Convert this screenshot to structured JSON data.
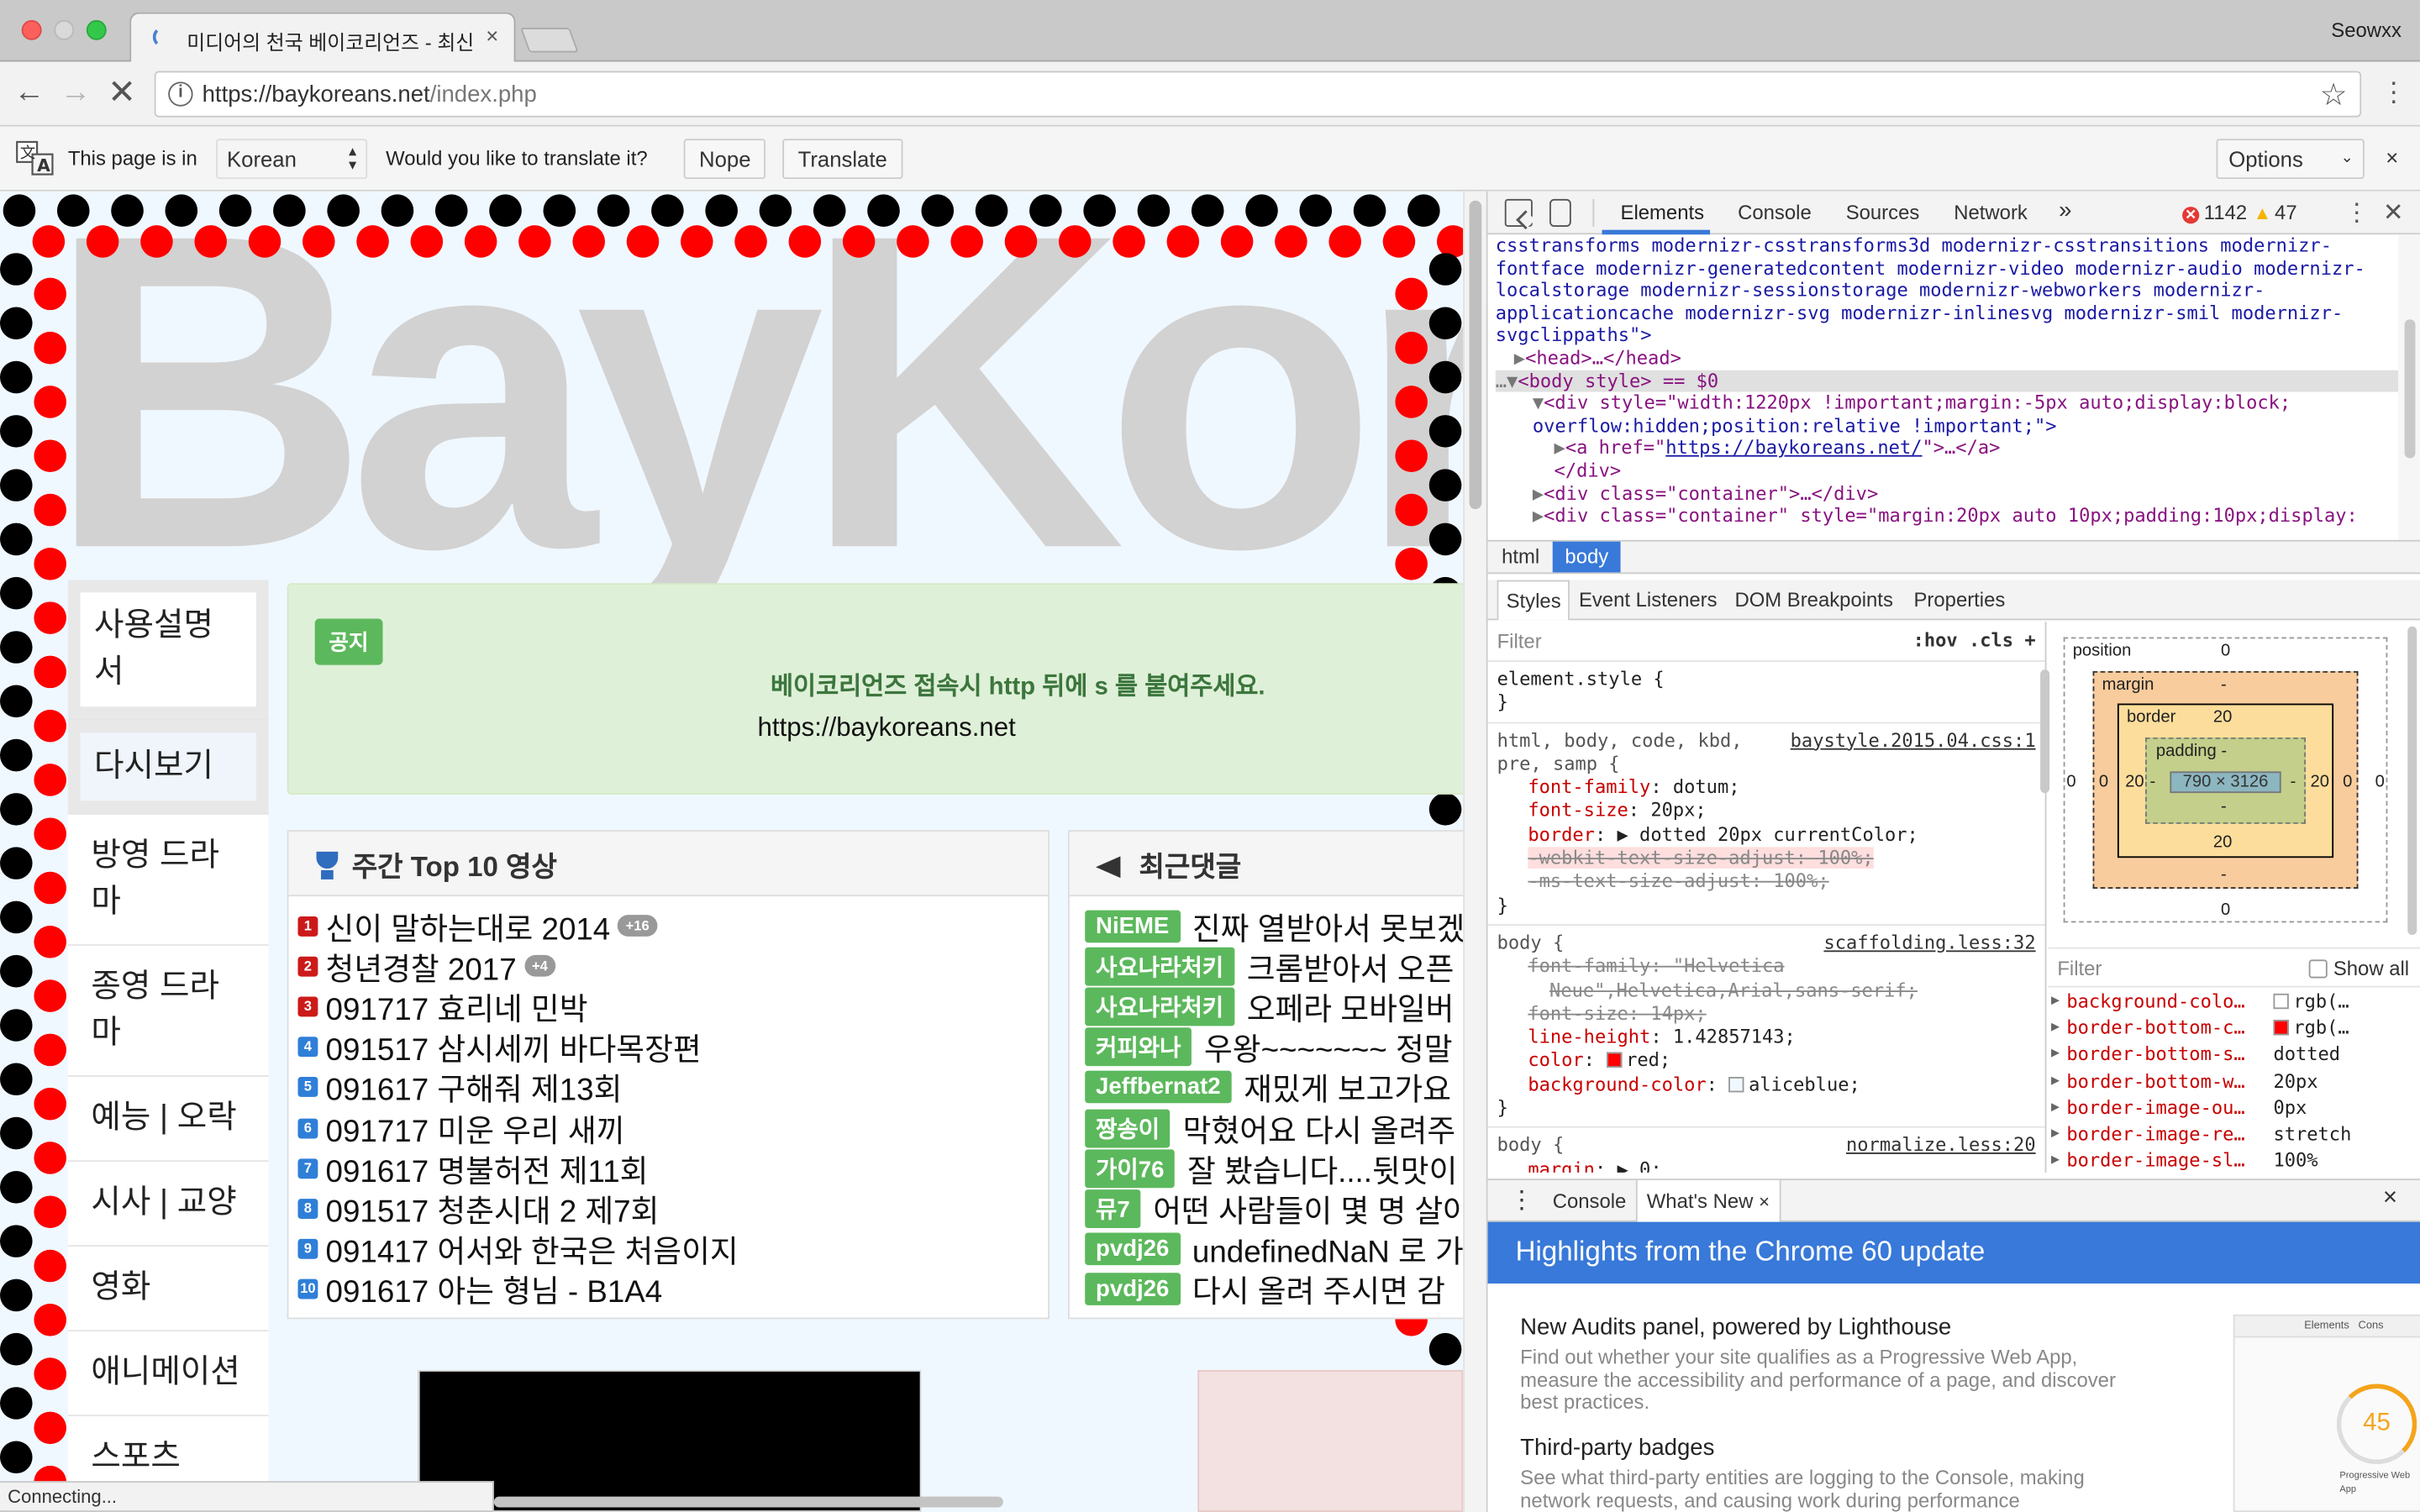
{
  "browser": {
    "tab_title": "미디어의 천국 베이코리언즈 - 최신 드",
    "tab_close": "×",
    "profile_name": "Seowxx",
    "url_host": "https://baykoreans.net",
    "url_path": "/index.php",
    "status_text": "Connecting..."
  },
  "translate_bar": {
    "prefix": "This page is in",
    "language": "Korean",
    "question": "Would you like to translate it?",
    "nope_label": "Nope",
    "translate_label": "Translate",
    "options_label": "Options",
    "close": "×"
  },
  "page": {
    "logo_text": "BayKore",
    "sidebar": [
      "사용설명서",
      "다시보기",
      "방영 드라마",
      "종영 드라마",
      "예능 | 오락",
      "시사 | 교양",
      "영화",
      "애니메이션",
      "스포츠"
    ],
    "notice": {
      "badge": "공지",
      "message": "베이코리언즈 접속시 http 뒤에 s 를 붙여주세요.",
      "link": "https://baykoreans.net"
    },
    "top10": {
      "title": "주간 Top 10 영상",
      "items": [
        {
          "rank": "1",
          "title": "신이 말하는대로 2014",
          "badge": "+16"
        },
        {
          "rank": "2",
          "title": "청년경찰 2017",
          "badge": "+4"
        },
        {
          "rank": "3",
          "title": "091717 효리네 민박",
          "badge": ""
        },
        {
          "rank": "4",
          "title": "091517 삼시세끼 바다목장편",
          "badge": ""
        },
        {
          "rank": "5",
          "title": "091617 구해줘 제13회",
          "badge": ""
        },
        {
          "rank": "6",
          "title": "091717 미운 우리 새끼",
          "badge": ""
        },
        {
          "rank": "7",
          "title": "091617 명불허전 제11회",
          "badge": ""
        },
        {
          "rank": "8",
          "title": "091517 청춘시대 2 제7회",
          "badge": ""
        },
        {
          "rank": "9",
          "title": "091417 어서와 한국은 처음이지",
          "badge": ""
        },
        {
          "rank": "10",
          "title": "091617 아는 형님 - B1A4",
          "badge": ""
        }
      ]
    },
    "comments": {
      "title": "최근댓글",
      "items": [
        {
          "user": "NiEME",
          "text": "진짜 열받아서 못보겠"
        },
        {
          "user": "사요나라처키",
          "text": "크롬받아서 오픈"
        },
        {
          "user": "사요나라처키",
          "text": "오페라 모바일버"
        },
        {
          "user": "커피와나",
          "text": "우왕~~~~~~~ 정말"
        },
        {
          "user": "Jeffbernat2",
          "text": "재밌게 보고가요"
        },
        {
          "user": "짱송이",
          "text": "막혔어요 다시 올려주"
        },
        {
          "user": "가이76",
          "text": "잘 봤습니다....뒷맛이"
        },
        {
          "user": "뮤7",
          "text": "어떤 사람들이 몇 명 살아"
        },
        {
          "user": "pvdj26",
          "text": "undefinedNaN 로 가"
        },
        {
          "user": "pvdj26",
          "text": "다시 올려 주시면 감"
        }
      ]
    }
  },
  "devtools": {
    "tabs": [
      "Elements",
      "Console",
      "Sources",
      "Network",
      "»"
    ],
    "error_count": "1142",
    "warning_count": "47",
    "dom_lines": [
      "csstransforms modernizr-csstransforms3d modernizr-csstransitions modernizr-",
      "fontface modernizr-generatedcontent modernizr-video modernizr-audio modernizr-",
      "localstorage modernizr-sessionstorage modernizr-webworkers modernizr-",
      "applicationcache modernizr-svg modernizr-inlinesvg modernizr-smil modernizr-",
      "svgclippaths\">"
    ],
    "dom_head": "<head>…</head>",
    "dom_body": "<body style> == $0",
    "dom_div1a": "<div style=\"width:1220px !important;margin:-5px auto;display:block;",
    "dom_div1b": "overflow:hidden;position:relative !important;\">",
    "dom_a_prefix": "<a href=\"",
    "dom_a_link": "https://baykoreans.net/",
    "dom_a_suffix": "\">…</a>",
    "dom_div_close": "</div>",
    "dom_container1": "<div class=\"container\">…</div>",
    "dom_container2": "<div class=\"container\" style=\"margin:20px auto 10px;padding:10px;display:",
    "crumbs": [
      "html",
      "body"
    ],
    "sub_tabs": [
      "Styles",
      "Event Listeners",
      "DOM Breakpoints",
      "Properties"
    ],
    "filter_placeholder": "Filter",
    "filter_tools": ":hov  .cls  +",
    "rules": {
      "element_style": "element.style {",
      "r1_selector": "html, body, code, kbd,",
      "r1_selector2": "pre, samp {",
      "r1_src": "baystyle.2015.04.css:1",
      "r1_props": [
        {
          "name": "font-family",
          "value": "dotum;"
        },
        {
          "name": "font-size",
          "value": "20px;"
        },
        {
          "name": "border",
          "value": "▶ dotted 20px currentColor;"
        }
      ],
      "r1_webkit": "-webkit-text-size-adjust: 100%;",
      "r1_ms": "-ms-text-size-adjust: 100%;",
      "r2_selector": "body {",
      "r2_src": "scaffolding.less:32",
      "r2_strike1": "font-family: \"Helvetica",
      "r2_strike1b": "Neue\",Helvetica,Arial,sans-serif;",
      "r2_strike2": "font-size: 14px;",
      "r2_props": [
        {
          "name": "line-height",
          "value": "1.42857143;"
        },
        {
          "name": "color",
          "value": "red;",
          "swatch": "#ff0000"
        },
        {
          "name": "background-color",
          "value": "aliceblue;",
          "swatch": "#f0f8ff"
        }
      ],
      "r3_selector": "body {",
      "r3_src": "normalize.less:20",
      "r3_prop": {
        "name": "margin",
        "value": "▶ 0;"
      },
      "close_brace": "}"
    },
    "box_model": {
      "position_label": "position",
      "position_value": "0",
      "margin_label": "margin",
      "margin_top": "-",
      "margin_bottom": "-",
      "margin_left": "0",
      "margin_right": "0",
      "border_label": "border",
      "border_value": "20",
      "border_left": "20",
      "border_right": "20",
      "border_bottom": "20",
      "padding_label": "padding -",
      "padding_left": "-",
      "padding_right": "-",
      "padding_bottom": "-",
      "content": "790 × 3126",
      "content_bottom": "-",
      "outer_left": "0",
      "outer_right": "0",
      "outer_bottom": "0"
    },
    "computed_filter": "Filter",
    "show_all": "Show all",
    "computed": [
      {
        "k": "background-colo…",
        "v": "rgb(…",
        "swatch": "#ffffff"
      },
      {
        "k": "border-bottom-c…",
        "v": "rgb(…",
        "swatch": "#ff0000"
      },
      {
        "k": "border-bottom-s…",
        "v": "dotted"
      },
      {
        "k": "border-bottom-w…",
        "v": "20px"
      },
      {
        "k": "border-image-ou…",
        "v": "0px"
      },
      {
        "k": "border-image-re…",
        "v": "stretch"
      },
      {
        "k": "border-image-sl…",
        "v": "100%"
      }
    ],
    "drawer": {
      "console_tab": "Console",
      "whatsnew_tab": "What's New",
      "tab_close": "×",
      "close": "×",
      "heading": "Highlights from the Chrome 60 update",
      "item1_title": "New Audits panel, powered by Lighthouse",
      "item1_desc": "Find out whether your site qualifies as a Progressive Web App, measure the accessibility and performance of a page, and discover best practices.",
      "item2_title": "Third-party badges",
      "item2_desc": "See what third-party entities are logging to the Console, making network requests, and causing work during performance",
      "shot_tab": "Elements",
      "shot_tab2": "Cons",
      "shot_score": "45",
      "shot_caption": "Progressive Web App"
    }
  }
}
